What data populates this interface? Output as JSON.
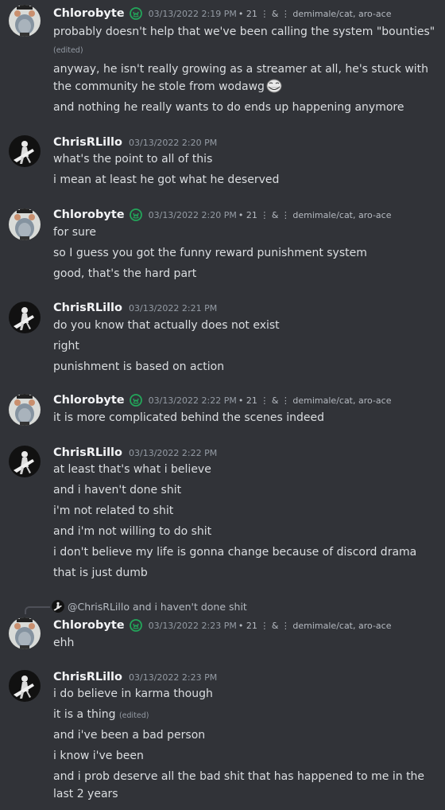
{
  "colors": {
    "background": "#313338",
    "text": "#dbdee1",
    "username": "#f2f3f5",
    "timestamp": "#949ba4",
    "badge": "#23a55a"
  },
  "users": {
    "chlorobyte": {
      "name": "Chlorobyte",
      "badge_icon": "cat-circle-icon",
      "meta": "• 21 ⋮ & ⋮ demimale/cat, aro-ace"
    },
    "chris": {
      "name": "ChrisRLillo"
    }
  },
  "messages": [
    {
      "author": "Chlorobyte",
      "timestamp": "03/13/2022 2:19 PM",
      "meta": "• 21 ⋮ & ⋮ demimale/cat, aro-ace",
      "lines": [
        "probably doesn't help that we've been calling the system \"bounties\"",
        "anyway, he isn't really growing as a streamer at all, he's stuck with the community he stole from wodawg",
        "and nothing he really wants to do ends up happening anymore"
      ],
      "edited_label": "(edited)",
      "emoji": "trollface-emoji"
    },
    {
      "author": "ChrisRLillo",
      "timestamp": "03/13/2022 2:20 PM",
      "lines": [
        "what's the point to all of this",
        "i mean at least he got what he deserved"
      ]
    },
    {
      "author": "Chlorobyte",
      "timestamp": "03/13/2022 2:20 PM",
      "meta": "• 21 ⋮ & ⋮ demimale/cat, aro-ace",
      "lines": [
        "for sure",
        "so I guess you got the funny reward punishment system",
        "good, that's the hard part"
      ]
    },
    {
      "author": "ChrisRLillo",
      "timestamp": "03/13/2022 2:21 PM",
      "lines": [
        "do you know that actually does not exist",
        "right",
        "punishment is based on action"
      ]
    },
    {
      "author": "Chlorobyte",
      "timestamp": "03/13/2022 2:22 PM",
      "meta": "• 21 ⋮ & ⋮ demimale/cat, aro-ace",
      "lines": [
        "it is more complicated behind the scenes indeed"
      ]
    },
    {
      "author": "ChrisRLillo",
      "timestamp": "03/13/2022 2:22 PM",
      "lines": [
        "at least that's what i believe",
        "and i haven't done shit",
        "i'm not related to shit",
        "and i'm not willing to do shit",
        "i don't believe my life is gonna change because of discord drama",
        "that is just dumb"
      ]
    },
    {
      "author": "Chlorobyte",
      "timestamp": "03/13/2022 2:23 PM",
      "meta": "• 21 ⋮ & ⋮ demimale/cat, aro-ace",
      "reply": {
        "mention": "@ChrisRLillo",
        "text": "and i haven't done shit"
      },
      "lines": [
        "ehh"
      ]
    },
    {
      "author": "ChrisRLillo",
      "timestamp": "03/13/2022 2:23 PM",
      "lines": [
        "i do believe in karma though",
        "it is a thing",
        "and i've been a bad person",
        "i know i've been",
        "and i prob deserve all the bad shit that has happened to me in the last 2 years"
      ],
      "edited_label": "(edited)"
    }
  ]
}
